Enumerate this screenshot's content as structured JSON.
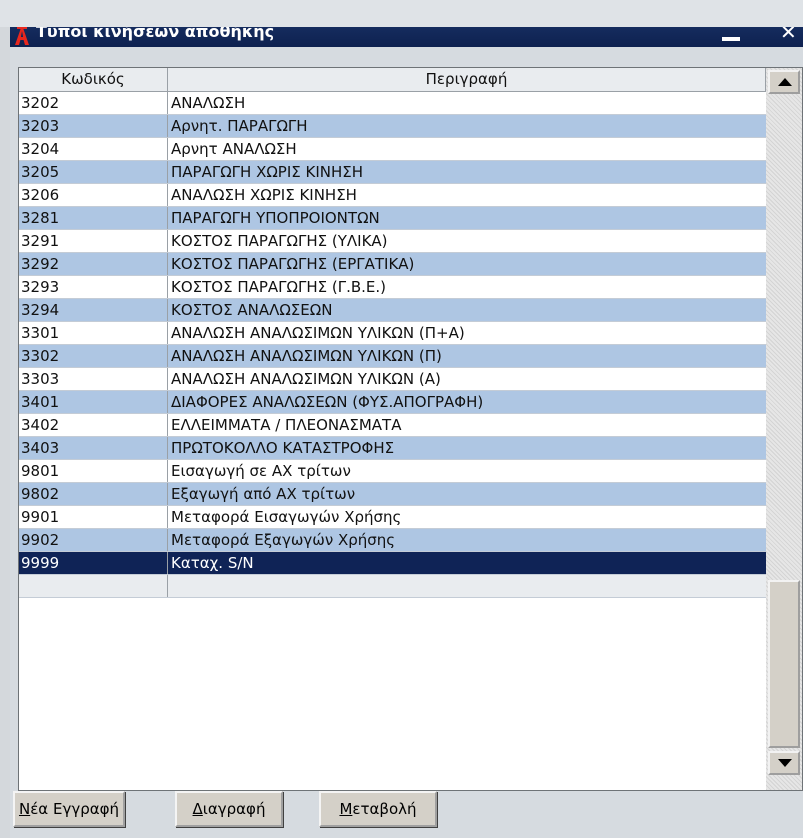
{
  "window": {
    "title": "Τύποι κινήσεων αποθήκης",
    "close_label": "✕"
  },
  "table": {
    "columns": [
      "Κωδικός",
      "Περιγραφή"
    ],
    "rows": [
      {
        "code": "3202",
        "desc": "ΑΝΑΛΩΣΗ"
      },
      {
        "code": "3203",
        "desc": "Αρνητ. ΠΑΡΑΓΩΓΗ"
      },
      {
        "code": "3204",
        "desc": "Αρνητ ΑΝΑΛΩΣΗ"
      },
      {
        "code": "3205",
        "desc": "ΠΑΡΑΓΩΓΗ ΧΩΡΙΣ ΚΙΝΗΣΗ"
      },
      {
        "code": "3206",
        "desc": "ΑΝΑΛΩΣΗ ΧΩΡΙΣ ΚΙΝΗΣΗ"
      },
      {
        "code": "3281",
        "desc": "ΠΑΡΑΓΩΓΗ ΥΠΟΠΡΟΙΟΝΤΩΝ"
      },
      {
        "code": "3291",
        "desc": "ΚΟΣΤΟΣ ΠΑΡΑΓΩΓΗΣ (ΥΛΙΚΑ)"
      },
      {
        "code": "3292",
        "desc": "ΚΟΣΤΟΣ ΠΑΡΑΓΩΓΗΣ (ΕΡΓΑΤΙΚΑ)"
      },
      {
        "code": "3293",
        "desc": "ΚΟΣΤΟΣ ΠΑΡΑΓΩΓΗΣ (Γ.Β.Ε.)"
      },
      {
        "code": "3294",
        "desc": "ΚΟΣΤΟΣ ΑΝΑΛΩΣΕΩΝ"
      },
      {
        "code": "3301",
        "desc": "ΑΝΑΛΩΣΗ ΑΝΑΛΩΣΙΜΩΝ ΥΛΙΚΩΝ (Π+Α)"
      },
      {
        "code": "3302",
        "desc": "ΑΝΑΛΩΣΗ ΑΝΑΛΩΣΙΜΩΝ ΥΛΙΚΩΝ (Π)"
      },
      {
        "code": "3303",
        "desc": "ΑΝΑΛΩΣΗ ΑΝΑΛΩΣΙΜΩΝ ΥΛΙΚΩΝ (Α)"
      },
      {
        "code": "3401",
        "desc": "ΔΙΑΦΟΡΕΣ ΑΝΑΛΩΣΕΩΝ (ΦΥΣ.ΑΠΟΓΡΑΦΗ)"
      },
      {
        "code": "3402",
        "desc": "ΕΛΛΕΙΜΜΑΤΑ / ΠΛΕΟΝΑΣΜΑΤΑ"
      },
      {
        "code": "3403",
        "desc": "ΠΡΩΤΟΚΟΛΛΟ ΚΑΤΑΣΤΡΟΦΗΣ"
      },
      {
        "code": "9801",
        "desc": "Εισαγωγή σε ΑΧ τρίτων"
      },
      {
        "code": "9802",
        "desc": "Εξαγωγή από ΑΧ τρίτων"
      },
      {
        "code": "9901",
        "desc": "Μεταφορά Εισαγωγών Χρήσης"
      },
      {
        "code": "9902",
        "desc": "Μεταφορά Εξαγωγών Χρήσης"
      },
      {
        "code": "9999",
        "desc": "Καταχ. S/N"
      }
    ],
    "selected_code": "9999"
  },
  "buttons": {
    "new_first": "Ν",
    "new_rest": "έα Εγγραφή",
    "delete_first": "Δ",
    "delete_rest": "ιαγραφή",
    "modify_first": "Μ",
    "modify_rest": "εταβολή"
  },
  "colors": {
    "title_bar": "#0e2150",
    "row_alt": "#aec6e3",
    "row_selected": "#0f2356"
  }
}
